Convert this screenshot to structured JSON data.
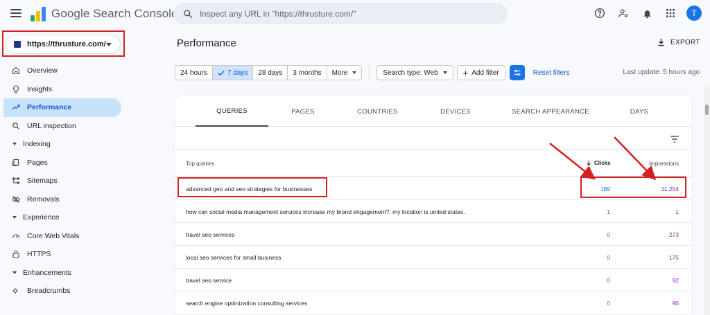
{
  "app": {
    "title": "Google Search Console",
    "search_placeholder": "Inspect any URL in \"https://thrusture.com/\"",
    "avatar_letter": "T"
  },
  "property": {
    "label": "https://thrusture.com/"
  },
  "sidebar": {
    "items": [
      {
        "label": "Overview",
        "icon": "home-icon"
      },
      {
        "label": "Insights",
        "icon": "lightbulb-icon"
      },
      {
        "label": "Performance",
        "icon": "trending-up-icon",
        "active": true
      },
      {
        "label": "URL inspection",
        "icon": "search-icon"
      }
    ],
    "indexing": {
      "label": "Indexing",
      "items": [
        {
          "label": "Pages",
          "icon": "pages-icon"
        },
        {
          "label": "Sitemaps",
          "icon": "sitemap-icon"
        },
        {
          "label": "Removals",
          "icon": "removals-icon"
        }
      ]
    },
    "experience": {
      "label": "Experience",
      "items": [
        {
          "label": "Core Web Vitals",
          "icon": "speed-icon"
        },
        {
          "label": "HTTPS",
          "icon": "lock-icon"
        }
      ]
    },
    "enhancements": {
      "label": "Enhancements",
      "items": [
        {
          "label": "Breadcrumbs",
          "icon": "breadcrumbs-icon"
        }
      ]
    }
  },
  "main": {
    "title": "Performance",
    "export_label": "EXPORT",
    "date_ranges": [
      "24 hours",
      "7 days",
      "28 days",
      "3 months"
    ],
    "selected_range": "7 days",
    "more_label": "More",
    "search_type_label": "Search type: Web",
    "add_filter_label": "Add filter",
    "reset_filters_label": "Reset filters",
    "last_update": "Last update: 5 hours ago",
    "tabs": [
      "QUERIES",
      "PAGES",
      "COUNTRIES",
      "DEVICES",
      "SEARCH APPEARANCE",
      "DAYS"
    ],
    "active_tab": "QUERIES"
  },
  "table": {
    "headers": {
      "query": "Top queries",
      "clicks": "Clicks",
      "impressions": "Impressions"
    },
    "rows": [
      {
        "query": "advanced geo and seo strategies for businesses",
        "clicks": "189",
        "impressions": "11,254"
      },
      {
        "query": "how can social media management services increase my brand engagement?. my location is united states.",
        "clicks": "1",
        "impressions": "1"
      },
      {
        "query": "travel seo services",
        "clicks": "0",
        "impressions": "273"
      },
      {
        "query": "local seo services for small business",
        "clicks": "0",
        "impressions": "175"
      },
      {
        "query": "travel seo service",
        "clicks": "0",
        "impressions": "92"
      },
      {
        "query": "search engine optimization consulting services",
        "clicks": "0",
        "impressions": "90"
      }
    ]
  },
  "colors": {
    "accent": "#1a73e8",
    "active_nav": "#c9e2fb",
    "clicks": "#1a73e8",
    "impressions": "#8e24aa",
    "annotation": "#d32020"
  }
}
